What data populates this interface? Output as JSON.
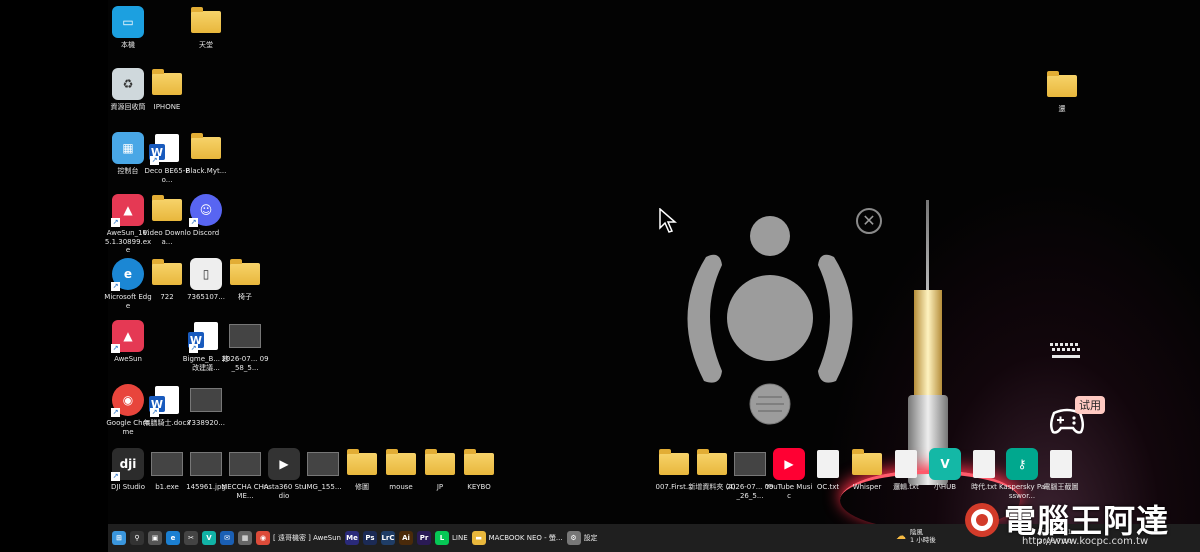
{
  "desktop": {
    "left_icons": [
      {
        "label": "本機",
        "kind": "monitor"
      },
      {
        "label": "天堂",
        "kind": "folder"
      },
      {
        "label": "資源回收筒",
        "kind": "recycle"
      },
      {
        "label": "IPHONE",
        "kind": "folder"
      },
      {
        "label": "控制台",
        "kind": "control-panel"
      },
      {
        "label": "Deco BE65-Po...",
        "kind": "word"
      },
      {
        "label": "Black.Myt...",
        "kind": "folder"
      },
      {
        "label": "AweSun_16.5.1.30899.exe",
        "kind": "awesun"
      },
      {
        "label": "Video Downloa...",
        "kind": "folder"
      },
      {
        "label": "Discord",
        "kind": "discord"
      },
      {
        "label": "Microsoft Edge",
        "kind": "edge"
      },
      {
        "label": "722",
        "kind": "folder"
      },
      {
        "label": "7365107...",
        "kind": "phone-image"
      },
      {
        "label": "椅子",
        "kind": "folder"
      },
      {
        "label": "AweSun",
        "kind": "awesun"
      },
      {
        "label": "Bigme_B... 修改建議...",
        "kind": "word"
      },
      {
        "label": "2026-07... 09_58_5...",
        "kind": "image"
      },
      {
        "label": "Google Chrome",
        "kind": "chrome"
      },
      {
        "label": "無膳騎士.docx",
        "kind": "word"
      },
      {
        "label": "7338920...",
        "kind": "image"
      }
    ],
    "bottom_icons": [
      {
        "label": "DJI Studio",
        "kind": "dji"
      },
      {
        "label": "b1.exe",
        "kind": "image"
      },
      {
        "label": "145961.jpg",
        "kind": "image"
      },
      {
        "label": "MECCHA CHAME...",
        "kind": "image"
      },
      {
        "label": "Insta360 Studio",
        "kind": "insta"
      },
      {
        "label": "IMG_155...",
        "kind": "image"
      },
      {
        "label": "修圖",
        "kind": "folder"
      },
      {
        "label": "mouse",
        "kind": "folder"
      },
      {
        "label": "JP",
        "kind": "folder"
      },
      {
        "label": "KEYBO",
        "kind": "folder"
      },
      {
        "label": "007.First...",
        "kind": "folder"
      },
      {
        "label": "新增資料夾 (4)",
        "kind": "folder"
      },
      {
        "label": "2026-07... 09_26_5...",
        "kind": "image"
      },
      {
        "label": "YouTube Music",
        "kind": "ytmusic"
      },
      {
        "label": "OC.txt",
        "kind": "doc"
      },
      {
        "label": "Whisper",
        "kind": "folder"
      },
      {
        "label": "邏輯.txt",
        "kind": "doc"
      },
      {
        "label": "小HUB",
        "kind": "vhub"
      },
      {
        "label": "時代.txt",
        "kind": "doc"
      },
      {
        "label": "Kaspersky Passwor...",
        "kind": "kaspersky"
      },
      {
        "label": "電腦王截圖",
        "kind": "doc"
      }
    ],
    "top_right_icon": {
      "label": "還",
      "kind": "folder"
    }
  },
  "overlay": {
    "close_symbol": "✕",
    "trial_label": "试用"
  },
  "taskbar": {
    "items": [
      {
        "label": "",
        "icon": "windows-start",
        "color": "#3a96dd"
      },
      {
        "label": "",
        "icon": "search",
        "color": "#333333"
      },
      {
        "label": "",
        "icon": "task-view",
        "color": "#555555"
      },
      {
        "label": "",
        "icon": "edge",
        "color": "#1b7fd1"
      },
      {
        "label": "",
        "icon": "capcut",
        "color": "#444444"
      },
      {
        "label": "",
        "icon": "vhub",
        "color": "#12b3a6"
      },
      {
        "label": "",
        "icon": "mail",
        "color": "#1a5fb4"
      },
      {
        "label": "",
        "icon": "calculator",
        "color": "#666666"
      },
      {
        "label": "[ 遠哥機密 ] AweSun",
        "icon": "chrome",
        "color": "#dd4b39"
      },
      {
        "label": "",
        "icon": "media-encoder",
        "color": "#2a2a7a"
      },
      {
        "label": "",
        "icon": "photoshop",
        "color": "#1b2a55"
      },
      {
        "label": "",
        "icon": "lightroom",
        "color": "#1f3d66"
      },
      {
        "label": "",
        "icon": "illustrator",
        "color": "#4a2a0a"
      },
      {
        "label": "",
        "icon": "premiere",
        "color": "#2a1a55"
      },
      {
        "label": "LINE",
        "icon": "line",
        "color": "#06c755"
      },
      {
        "label": "MACBOOK NEO - 螢...",
        "icon": "folder",
        "color": "#e8b73c"
      },
      {
        "label": "設定",
        "icon": "settings",
        "color": "#777777"
      }
    ],
    "tray": {
      "weather": "陰風",
      "weather_sub": "1 小時後",
      "time": "下午 02:31",
      "date": "2026/7/10"
    }
  },
  "watermark": {
    "brand": "電腦王阿達",
    "url": "http://www.kocpc.com.tw"
  }
}
